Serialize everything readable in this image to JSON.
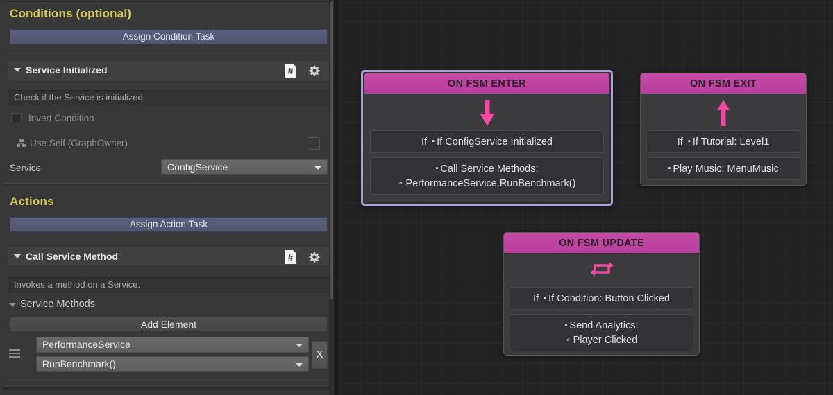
{
  "inspector": {
    "conditions": {
      "section_title": "Conditions (optional)",
      "assign_button": "Assign Condition Task",
      "task": {
        "name": "Service Initialized",
        "script_icon": "csharp-script-icon",
        "gear_icon": "gear-icon",
        "description": "Check if the Service is initialized.",
        "invert_label": "Invert Condition",
        "use_self_label": "Use Self (GraphOwner)",
        "service_label": "Service",
        "service_value": "ConfigService"
      }
    },
    "actions": {
      "section_title": "Actions",
      "assign_button": "Assign Action Task",
      "task": {
        "name": "Call Service Method",
        "script_icon": "csharp-script-icon",
        "gear_icon": "gear-icon",
        "description": "Invokes a method on a Service.",
        "list_foldout": "Service Methods",
        "add_element": "Add Element",
        "element": {
          "service": "PerformanceService",
          "method": "RunBenchmark()",
          "remove_label": "X"
        }
      }
    }
  },
  "graph": {
    "nodes": [
      {
        "title": "ON FSM ENTER",
        "icon": "arrow-down-icon",
        "selected": true,
        "rows": [
          {
            "prefix": "If",
            "bullet": "square",
            "text": "If ConfigService Initialized"
          },
          {
            "prefix": "",
            "bullet": "square",
            "text": "Call Service Methods:",
            "sub_bullet": "ring",
            "sub_text": "PerformanceService.RunBenchmark()"
          }
        ]
      },
      {
        "title": "ON FSM EXIT",
        "icon": "arrow-up-icon",
        "selected": false,
        "rows": [
          {
            "prefix": "If",
            "bullet": "square",
            "text": "If Tutorial: Level1"
          },
          {
            "prefix": "",
            "bullet": "square",
            "text": "Play Music: MenuMusic"
          }
        ]
      },
      {
        "title": "ON FSM UPDATE",
        "icon": "loop-refresh-icon",
        "selected": false,
        "rows": [
          {
            "prefix": "If",
            "bullet": "square",
            "text": "If Condition: Button Clicked"
          },
          {
            "prefix": "",
            "bullet": "square",
            "text": "Send Analytics:",
            "sub_bullet": "ring",
            "sub_text": "Player Clicked"
          }
        ]
      }
    ]
  },
  "colors": {
    "accent_yellow": "#d7c95a",
    "node_title_pink": "#c64aa8",
    "icon_pink": "#f0499f",
    "selection_lavender": "#a9a3d9",
    "assign_button_blue": "#5b5f80",
    "panel_bg": "#383838",
    "canvas_bg": "#232323"
  }
}
